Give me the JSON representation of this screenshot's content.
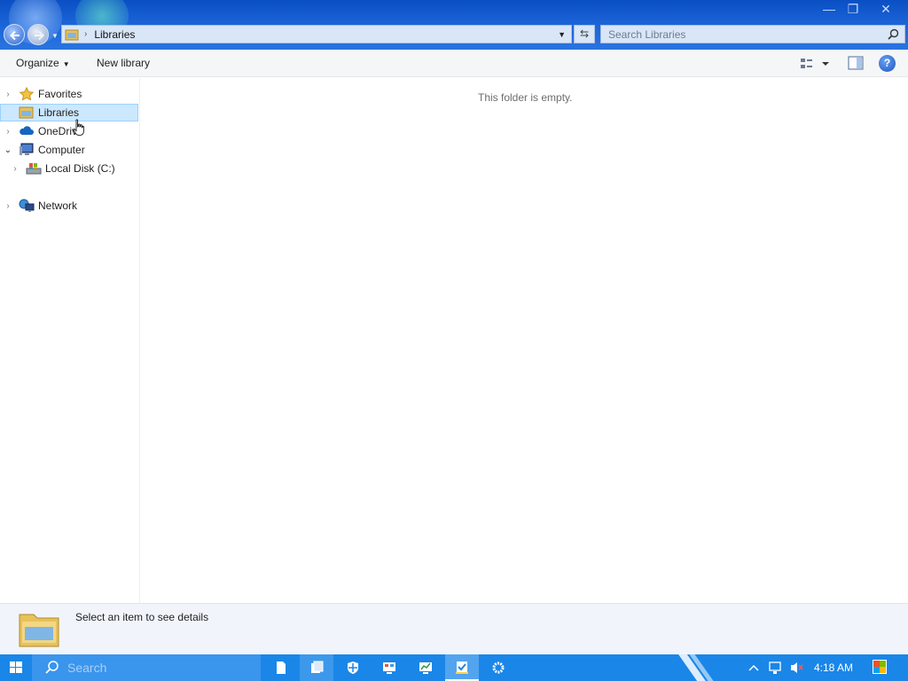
{
  "window": {
    "controls": {
      "minimize": "—",
      "restore": "❐",
      "close": "✕"
    }
  },
  "address_bar": {
    "path_separator": "›",
    "location": "Libraries",
    "dropdown_glyph": "▼",
    "refresh_glyph": "⇆"
  },
  "search": {
    "placeholder": "Search Libraries"
  },
  "toolbar": {
    "organize_label": "Organize",
    "organize_caret": "▼",
    "new_library_label": "New library",
    "help_glyph": "?"
  },
  "nav": {
    "items": [
      {
        "label": "Favorites",
        "icon": "star-icon",
        "expander": "›"
      },
      {
        "label": "Libraries",
        "icon": "libraries-icon",
        "expander": "",
        "selected": true
      },
      {
        "label": "OneDrive",
        "icon": "cloud-icon",
        "expander": "›"
      },
      {
        "label": "Computer",
        "icon": "computer-icon",
        "expander": "⌄"
      },
      {
        "label": "Local Disk (C:)",
        "icon": "drive-icon",
        "expander": "›"
      },
      {
        "label": "Network",
        "icon": "network-icon",
        "expander": "›"
      }
    ]
  },
  "content": {
    "empty_message": "This folder is empty."
  },
  "details": {
    "text": "Select an item to see details"
  },
  "taskbar": {
    "search_placeholder": "Search",
    "clock": "4:18 AM",
    "apps": [
      "file-icon",
      "explorer-icon",
      "defender-icon",
      "control-panel-icon",
      "monitor-icon",
      "task-icon",
      "settings-icon"
    ]
  },
  "colors": {
    "title_blue": "#1a63d6",
    "taskbar_blue": "#1a86e8",
    "selection": "#cce8ff",
    "details_bg": "#f1f5fb"
  }
}
